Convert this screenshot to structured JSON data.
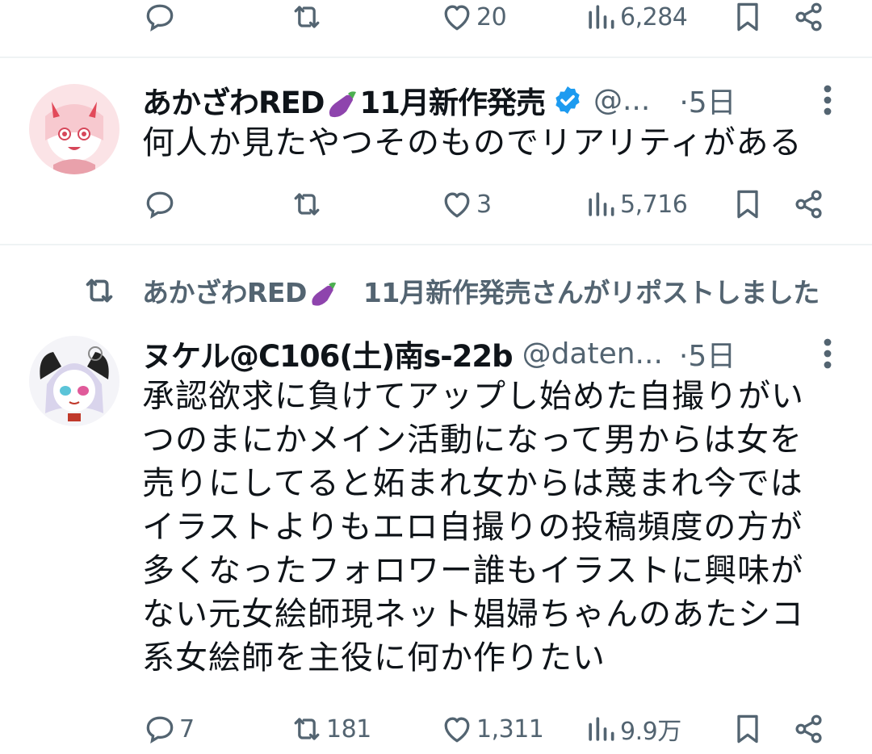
{
  "prev_tweet": {
    "actions": {
      "reply": "",
      "retweet": "",
      "like": "20",
      "views": "6,284"
    }
  },
  "tweet1": {
    "name": "あかざわRED",
    "name_suffix": "11月新作発売",
    "handle": "@...",
    "time": "·5日",
    "text": "何人か見たやつそのものでリアリティがある",
    "actions": {
      "reply": "",
      "retweet": "",
      "like": "3",
      "views": "5,716"
    }
  },
  "repost_banner": {
    "prefix": "あかざわRED",
    "suffix": "11月新作発売さんがリポストしました"
  },
  "tweet2": {
    "name": "ヌケル@C106(土)南s-22b",
    "handle": "@daten...",
    "time": "·5日",
    "text": "承認欲求に負けてアップし始めた自撮りがいつのまにかメイン活動になって男からは女を売りにしてると妬まれ女からは蔑まれ今ではイラストよりもエロ自撮りの投稿頻度の方が多くなったフォロワー誰もイラストに興味がない元女絵師現ネット娼婦ちゃんのあたシコ系女絵師を主役に何か作りたい",
    "actions": {
      "reply": "7",
      "retweet": "181",
      "like": "1,311",
      "views": "9.9万"
    }
  },
  "colors": {
    "text_primary": "#0f1419",
    "text_secondary": "#536471",
    "divider": "#eff3f4",
    "verified": "#1d9bf0"
  },
  "icons": [
    "reply-icon",
    "retweet-icon",
    "like-icon",
    "views-icon",
    "bookmark-icon",
    "share-icon",
    "verified-badge-icon",
    "more-icon",
    "eggplant-emoji"
  ]
}
